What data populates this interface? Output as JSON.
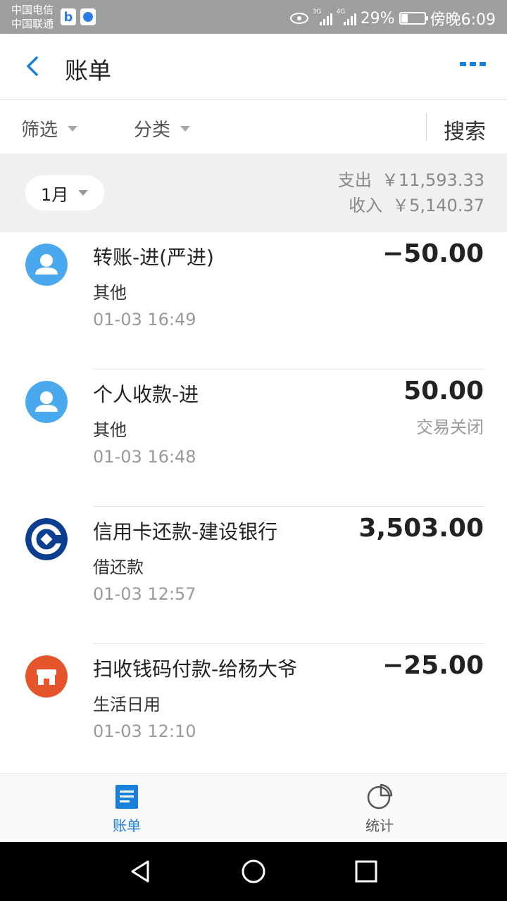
{
  "status_bar": {
    "carrier_1": "中国电信",
    "carrier_2": "中国联通",
    "net_1": "3G",
    "net_2": "4G",
    "battery": "29%",
    "time": "傍晚6:09"
  },
  "header": {
    "title": "账单"
  },
  "filters": {
    "filter_label": "筛选",
    "category_label": "分类",
    "search_label": "搜索"
  },
  "summary": {
    "month": "1月",
    "expense_label": "支出",
    "expense_value": "￥11,593.33",
    "income_label": "收入",
    "income_value": "￥5,140.37"
  },
  "transactions": [
    {
      "title": "转账-进(严进)",
      "category": "其他",
      "time": "01-03  16:49",
      "amount": "−50.00",
      "status": "",
      "icon": "person-icon"
    },
    {
      "title": "个人收款-进",
      "category": "其他",
      "time": "01-03  16:48",
      "amount": "50.00",
      "status": "交易关闭",
      "icon": "person-icon"
    },
    {
      "title": "信用卡还款-建设银行",
      "category": "借还款",
      "time": "01-03  12:57",
      "amount": "3,503.00",
      "status": "",
      "icon": "ccb-bank-icon"
    },
    {
      "title": "扫收钱码付款-给杨大爷",
      "category": "生活日用",
      "time": "01-03  12:10",
      "amount": "−25.00",
      "status": "",
      "icon": "shop-icon"
    }
  ],
  "tabbar": {
    "bill_label": "账单",
    "stats_label": "统计"
  },
  "colors": {
    "accent": "#1a7fd9",
    "person_avatar": "#4aa8ee",
    "bank_icon": "#0b3e8f",
    "shop_icon": "#e5542a"
  }
}
